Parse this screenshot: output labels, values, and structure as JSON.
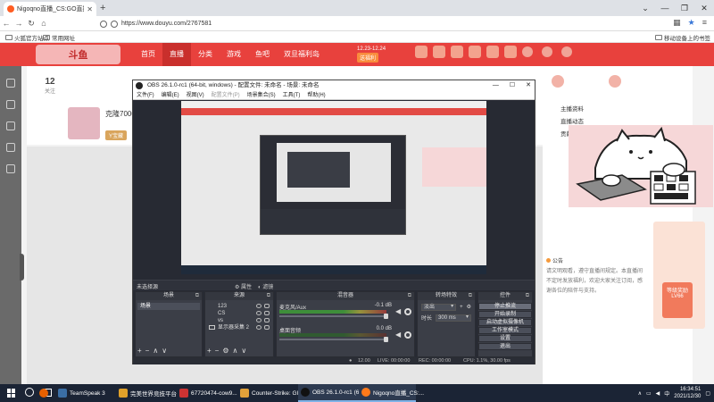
{
  "browser": {
    "tab_title": "Nigoqno直播_CS:GO直播_斗鱼...",
    "url": "https://www.douyu.com/2767581",
    "bookmarks": [
      "火狐官方站点",
      "常用网址"
    ],
    "bookmark_right": "移动设备上的书签"
  },
  "douyu": {
    "logo": "斗鱼",
    "nav": [
      "首页",
      "直播",
      "分类",
      "游戏",
      "鱼吧",
      "双旦福利岛"
    ],
    "promo": {
      "date": "12.23-12.24",
      "button": "送福利"
    },
    "followers_count": "12",
    "followers_label": "关注",
    "anchor_name": "克隆7000",
    "anchor_tag": "Y宝藏",
    "announce_label": "公告",
    "announce_text": "请文明观看，遵守直播间规定。本直播间不定时发放福利，欢迎大家关注订阅，感谢各位的陪伴与支持。",
    "right_links": [
      "主播资料",
      "直播动态",
      "贡献周榜"
    ],
    "right_side_text": "等级奖励",
    "right_side_sub": "LV66"
  },
  "obs": {
    "title": "OBS 26.1.0-rc1 (64-bit, windows) - 配置文件: 未命名 - 场景: 未命名",
    "menu": [
      "文件(F)",
      "编辑(E)",
      "视图(V)",
      "配置文件(P)",
      "场景集合(S)",
      "工具(T)",
      "帮助(H)"
    ],
    "selection": "未选择源",
    "bar_buttons": [
      "属性",
      "滤镜"
    ],
    "docks": {
      "scenes": {
        "title": "场景",
        "items": [
          "场景"
        ]
      },
      "sources": {
        "title": "来源",
        "items": [
          "123",
          "CS",
          "vs",
          "显示器采集 2"
        ]
      },
      "mixer": {
        "title": "混音器",
        "channels": [
          {
            "name": "麦克风/Aux",
            "db": "-0.1 dB"
          },
          {
            "name": "桌面音频",
            "db": "0.0 dB"
          }
        ]
      },
      "transitions": {
        "title": "转场特效",
        "type": "淡出",
        "duration_label": "时长",
        "duration": "300 ms"
      },
      "controls": {
        "title": "控件",
        "buttons": [
          "停止推流",
          "开始录制",
          "启动虚拟摄像机",
          "工作室模式",
          "设置",
          "退出"
        ]
      }
    },
    "status": {
      "live": "LIVE: 00:00:00",
      "rec": "REC: 00:00:00",
      "cpu": "CPU: 1.1%, 30.00 fps",
      "kbps": "12.00"
    }
  },
  "taskbar": {
    "apps": [
      {
        "label": "TeamSpeak 3",
        "color": "#3a6ea5"
      },
      {
        "label": "完美世界竞技平台",
        "color": "#e0a12a"
      },
      {
        "label": "67720474-cow9...",
        "color": "#c33"
      },
      {
        "label": "Counter-Strike: Gl...",
        "color": "#e1a13a"
      },
      {
        "label": "OBS 26.1.0-rc1 (6...",
        "color": "#333"
      },
      {
        "label": "Nigoqno直播_CS:...",
        "color": "#ff7a1a"
      }
    ],
    "time": "16:34:51",
    "date": "2021/12/30"
  },
  "colors": {
    "douyu_red": "#e8413d",
    "obs_bg": "#272a33"
  }
}
